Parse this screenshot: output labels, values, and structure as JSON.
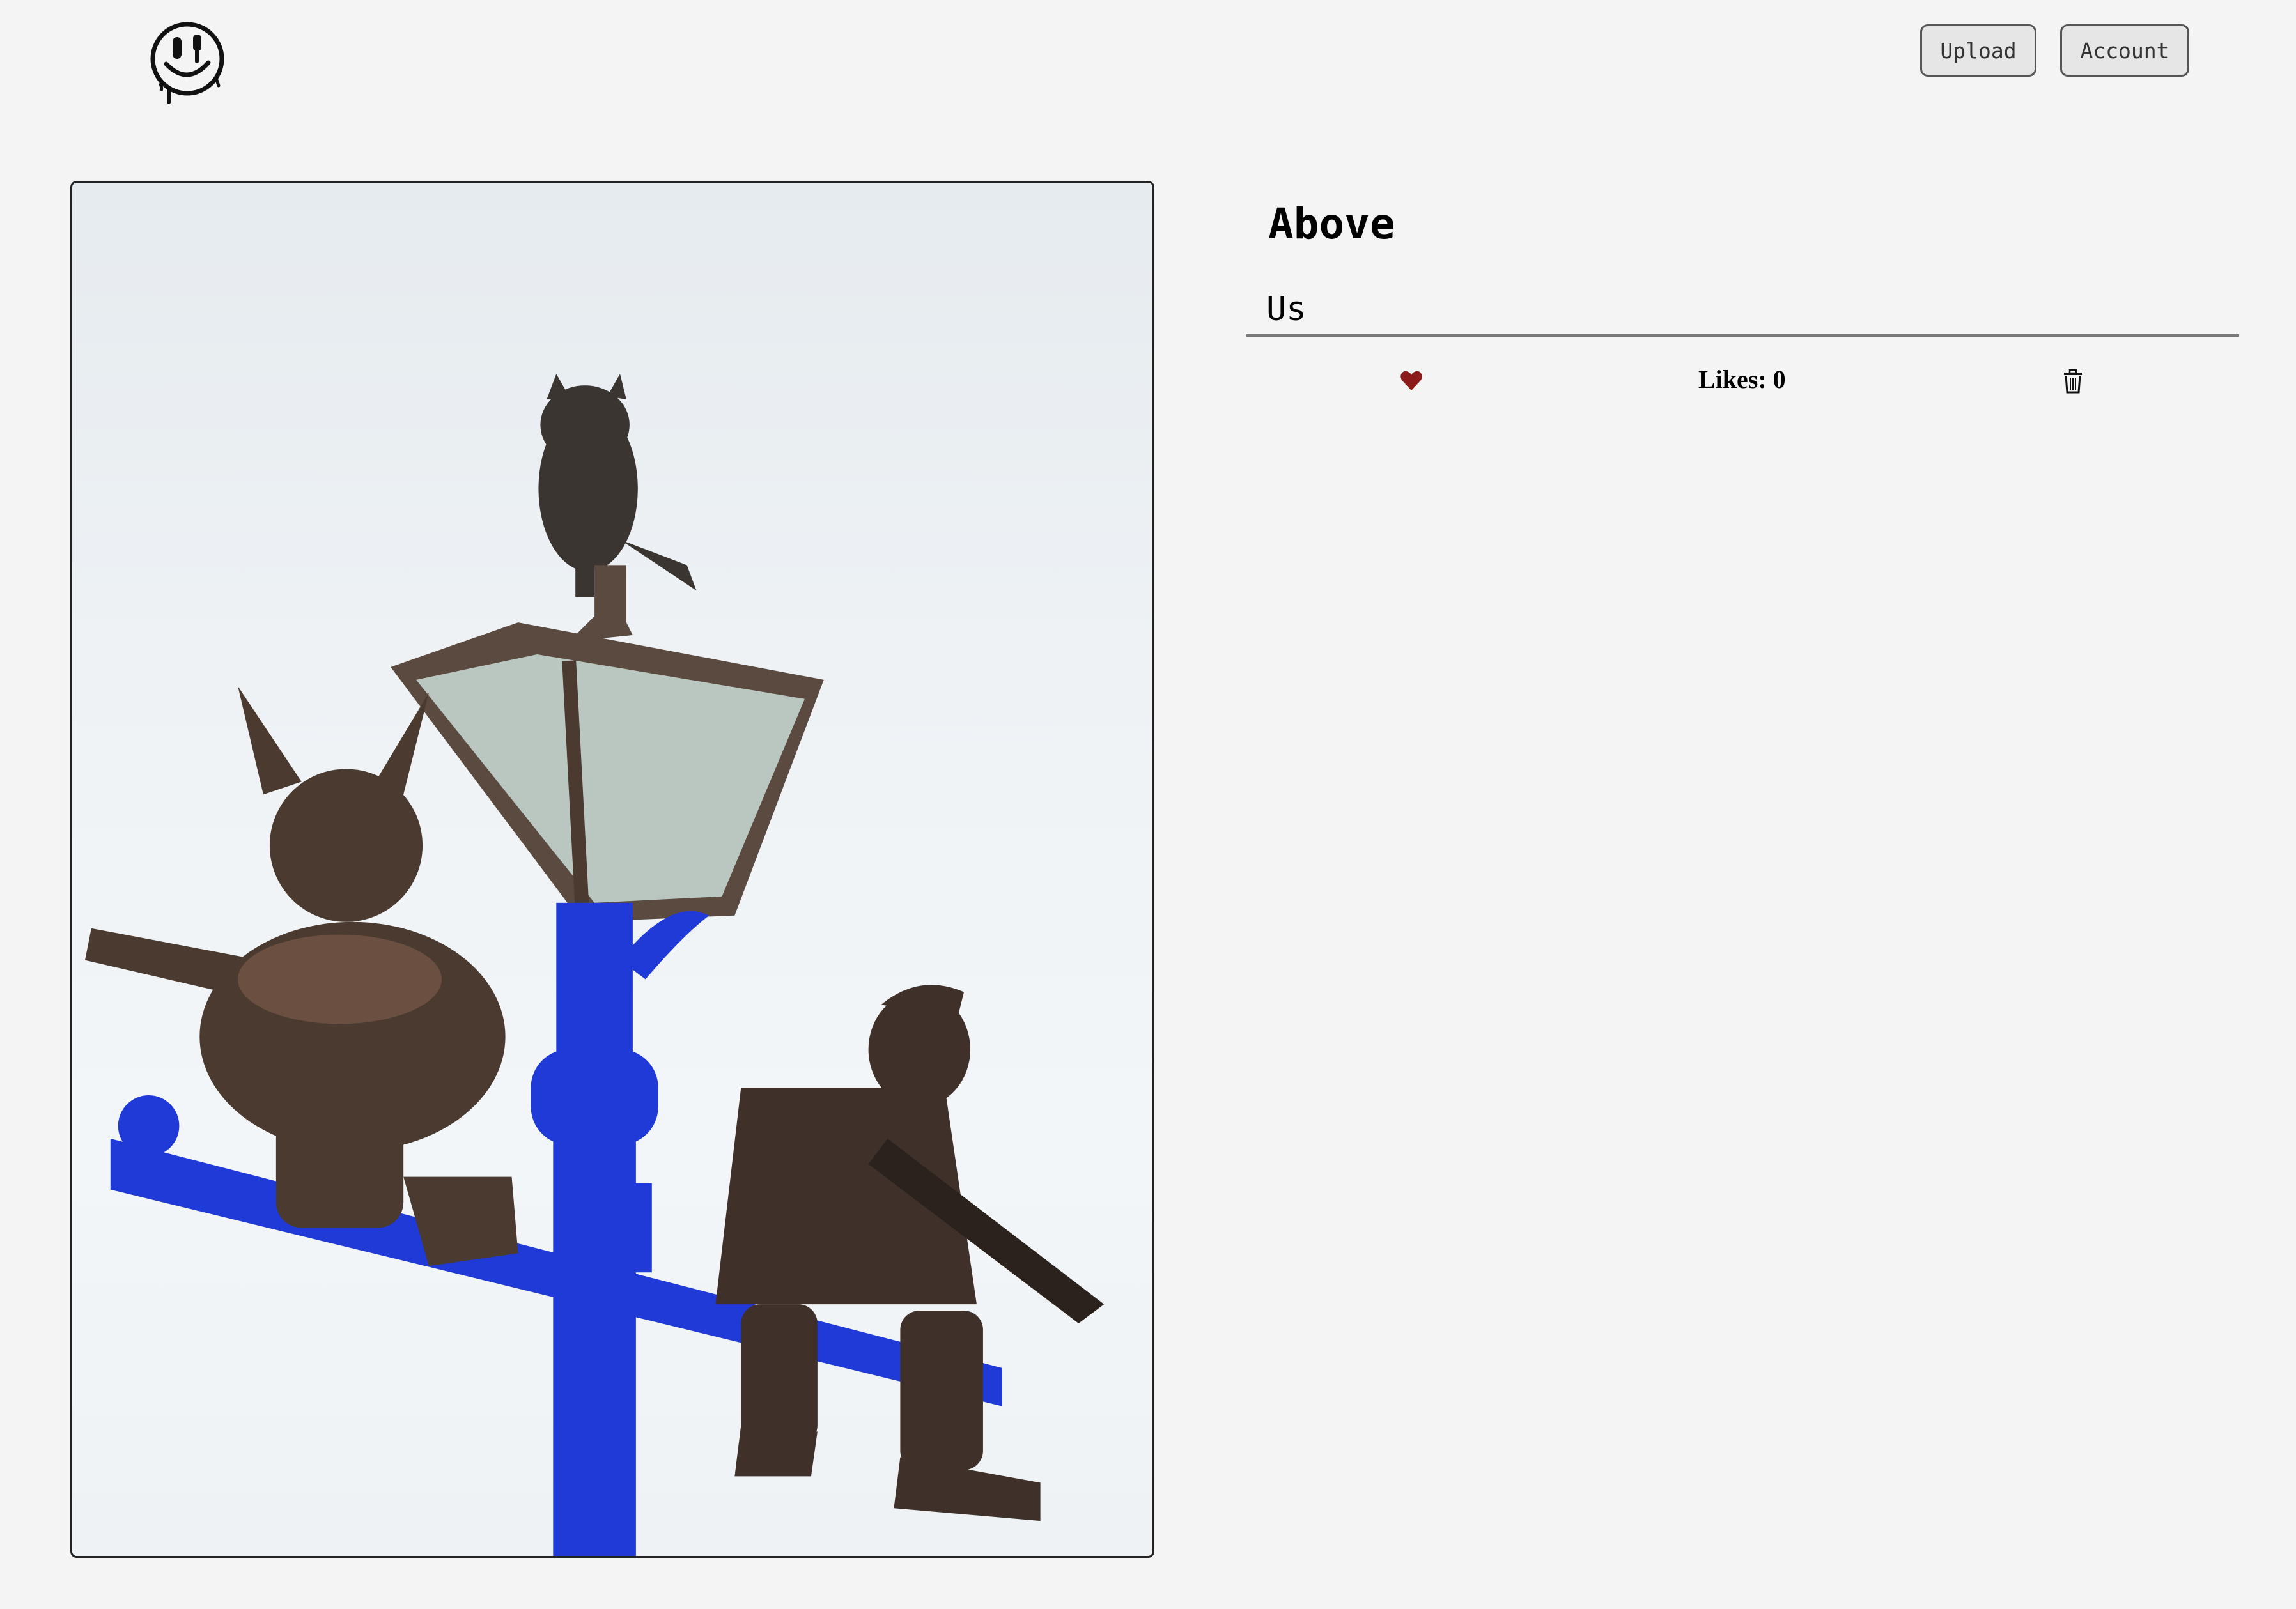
{
  "header": {
    "logo_icon": "drippy-smiley-logo-icon",
    "upload_label": "Upload",
    "account_label": "Account"
  },
  "post": {
    "image_icon": "lamppost-statue-photo",
    "title": "Above",
    "caption": "Us",
    "likes_label": "Likes: 0",
    "likes_count": 0,
    "like_icon": "heart-icon",
    "delete_icon": "trash-icon"
  },
  "colors": {
    "background": "#f4f4f4",
    "heart": "#8b1a1a",
    "lamppost_blue": "#1f3ad6",
    "bronze": "#4a3a30"
  }
}
